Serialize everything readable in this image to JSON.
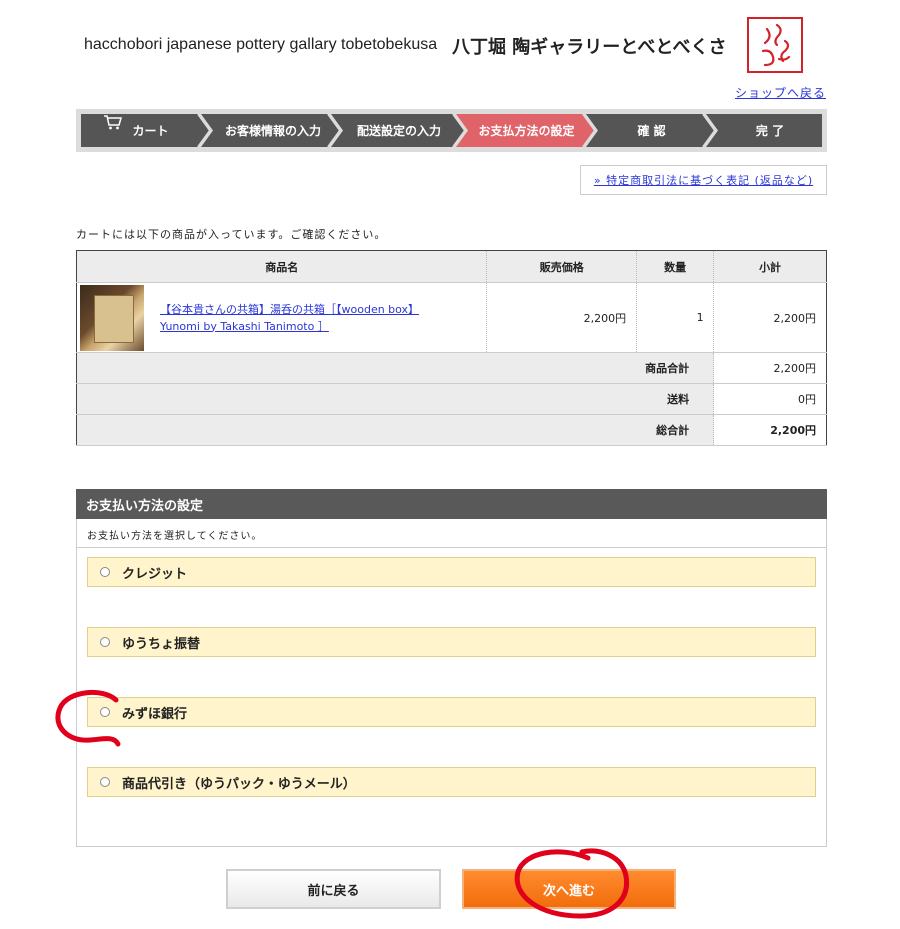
{
  "header": {
    "site_title_en": "hacchobori japanese pottery gallary tobetobekusa",
    "site_title_jp": "八丁堀 陶ギャラリーとべとべくさ",
    "back_to_shop": "ショップへ戻る"
  },
  "steps": {
    "items": [
      {
        "label": "カート"
      },
      {
        "label": "お客様情報の入力"
      },
      {
        "label": "配送設定の入力"
      },
      {
        "label": "お支払方法の設定"
      },
      {
        "label": "確 認"
      },
      {
        "label": "完 了"
      }
    ],
    "current_index": 3,
    "colors": {
      "step": "#555555",
      "current": "#e0636a"
    }
  },
  "legal_link": "» 特定商取引法に基づく表記 (返品など)",
  "cart_message": "カートには以下の商品が入っています。ご確認ください。",
  "cart": {
    "headers": {
      "name": "商品名",
      "price": "販売価格",
      "qty": "数量",
      "subtotal": "小計"
    },
    "items": [
      {
        "name_line1": "【谷本貴さんの共箱】湯呑の共箱［【wooden box】",
        "name_line2": "Yunomi by Takashi Tanimoto ］",
        "price": "2,200円",
        "qty": "1",
        "subtotal": "2,200円"
      }
    ],
    "summary": {
      "goods_total_label": "商品合計",
      "goods_total": "2,200円",
      "shipping_label": "送料",
      "shipping": "0円",
      "grand_total_label": "総合計",
      "grand_total": "2,200円"
    }
  },
  "payment": {
    "heading": "お支払い方法の設定",
    "note": "お支払い方法を選択してください。",
    "options": [
      {
        "label": "クレジット"
      },
      {
        "label": "ゆうちょ振替"
      },
      {
        "label": "みずほ銀行"
      },
      {
        "label": "商品代引き（ゆうパック・ゆうメール）"
      }
    ]
  },
  "buttons": {
    "back": "前に戻る",
    "next": "次へ進む"
  },
  "colors": {
    "link": "#2a36d8",
    "next_button": "#f26d0b",
    "option_bg": "#fff4cc",
    "annotation": "#e0001b"
  }
}
